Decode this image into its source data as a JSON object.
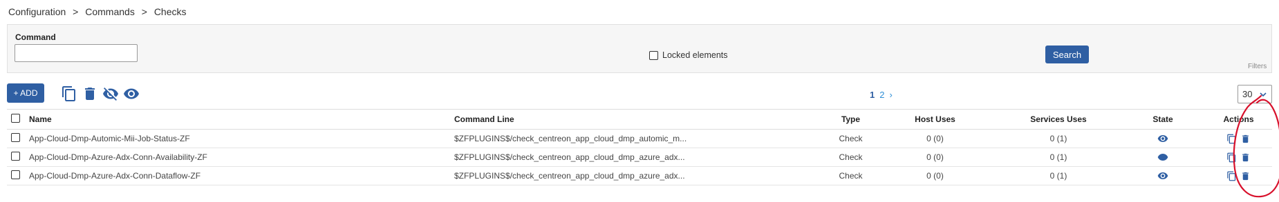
{
  "breadcrumb": [
    "Configuration",
    ">",
    "Commands",
    ">",
    "Checks"
  ],
  "filters": {
    "command_label": "Command",
    "command_value": "",
    "locked_label": "Locked elements",
    "search_label": "Search",
    "panel_label": "Filters"
  },
  "toolbar": {
    "add_label": "+ ADD",
    "icons": [
      "duplicate-icon",
      "delete-icon",
      "hide-icon",
      "show-icon"
    ]
  },
  "pagination": {
    "current": "1",
    "next_page": "2",
    "next_arrow": "›"
  },
  "per_page": "30",
  "table": {
    "headers": {
      "name": "Name",
      "command_line": "Command Line",
      "type": "Type",
      "host_uses": "Host Uses",
      "services_uses": "Services Uses",
      "state": "State",
      "actions": "Actions"
    },
    "rows": [
      {
        "name": "App-Cloud-Dmp-Automic-Mii-Job-Status-ZF",
        "command_line": "$ZFPLUGINS$/check_centreon_app_cloud_dmp_automic_m...",
        "type": "Check",
        "host_uses": "0 (0)",
        "services_uses": "0 (1)"
      },
      {
        "name": "App-Cloud-Dmp-Azure-Adx-Conn-Availability-ZF",
        "command_line": "$ZFPLUGINS$/check_centreon_app_cloud_dmp_azure_adx...",
        "type": "Check",
        "host_uses": "0 (0)",
        "services_uses": "0 (1)"
      },
      {
        "name": "App-Cloud-Dmp-Azure-Adx-Conn-Dataflow-ZF",
        "command_line": "$ZFPLUGINS$/check_centreon_app_cloud_dmp_azure_adx...",
        "type": "Check",
        "host_uses": "0 (0)",
        "services_uses": "0 (1)"
      }
    ]
  },
  "colors": {
    "primary": "#2f5fa3",
    "link": "#2f8fd6",
    "annotation": "#d8102b"
  }
}
